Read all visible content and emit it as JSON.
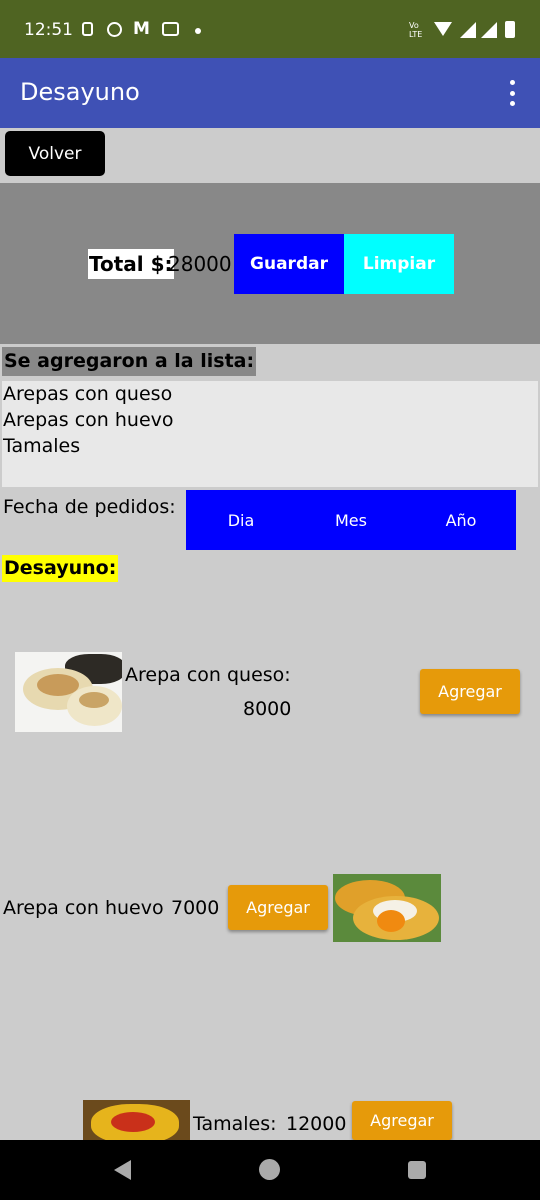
{
  "status_bar": {
    "time": "12:51",
    "icons": [
      "sim-icon",
      "play-icon",
      "gmail-icon",
      "message-icon",
      "dot-icon",
      "volte-icon",
      "wifi-icon",
      "signal-icon",
      "signal-icon",
      "battery-icon"
    ],
    "volte_text": "Vo LTE"
  },
  "app_bar": {
    "title": "Desayuno",
    "menu_icon": "more-vert-icon"
  },
  "volver_label": "Volver",
  "total": {
    "label": "Total $:",
    "value": "28000",
    "save_label": "Guardar",
    "clear_label": "Limpiar"
  },
  "added_list": {
    "title": "Se agregaron a la lista:",
    "items": [
      "Arepas con queso",
      "Arepas con huevo",
      "Tamales"
    ]
  },
  "date": {
    "label": "Fecha de pedidos:",
    "day": "Dia",
    "month": "Mes",
    "year": "Año"
  },
  "section_title": "Desayuno:",
  "products": [
    {
      "name": "Arepa con queso:",
      "price": "8000",
      "button": "Agregar"
    },
    {
      "name": "Arepa con huevo",
      "price": "7000",
      "button": "Agregar"
    },
    {
      "name": "Tamales:",
      "price": "12000",
      "button": "Agregar"
    }
  ],
  "colors": {
    "status_bar": "#4f6422",
    "app_bar": "#3f51b5",
    "background": "#cccccc",
    "total_bar": "#888888",
    "guardar": "#0000ff",
    "limpiar": "#00ffff",
    "date_box": "#0000ff",
    "section_highlight": "#ffff00",
    "agregar": "#e69a0a"
  }
}
